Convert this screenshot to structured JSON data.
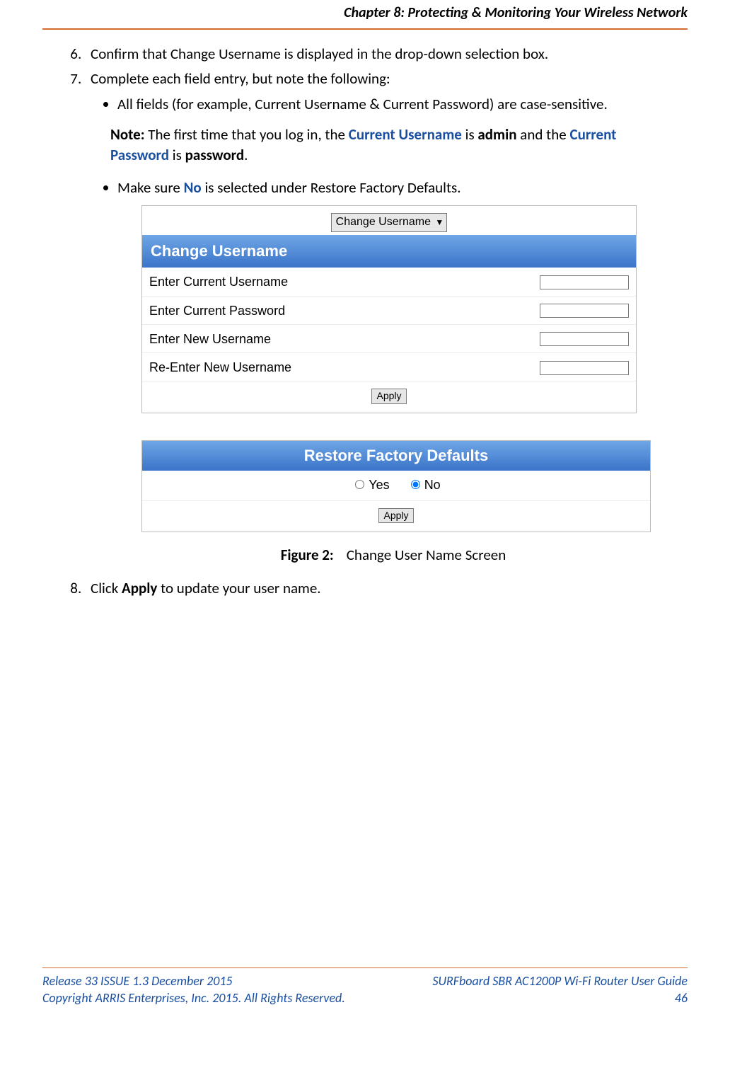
{
  "header": {
    "chapter_title": "Chapter 8: Protecting & Monitoring Your Wireless Network"
  },
  "steps": {
    "six": "Confirm that Change Username is displayed in the drop-down selection box.",
    "seven": "Complete each field entry, but note the following:",
    "bullet_a": "All fields (for example, Current Username & Current Password) are case-sensitive.",
    "note_label": "Note:",
    "note_1": " The first time that you log in, the ",
    "note_cu": "Current Username",
    "note_2": " is ",
    "note_admin": "admin",
    "note_3": " and the ",
    "note_cp": "Current Password",
    "note_4": " is ",
    "note_pw": "password",
    "note_5": ".",
    "bullet_b_1": "Make sure ",
    "bullet_b_no": "No",
    "bullet_b_2": " is selected under Restore Factory Defaults.",
    "eight_1": "Click ",
    "eight_apply": "Apply",
    "eight_2": " to update your user name."
  },
  "panel1": {
    "dropdown": "Change Username",
    "section_title": "Change Username",
    "row1": "Enter Current Username",
    "row2": "Enter Current Password",
    "row3": "Enter New Username",
    "row4": "Re-Enter New Username",
    "apply": "Apply"
  },
  "panel2": {
    "section_title": "Restore Factory Defaults",
    "yes": "Yes",
    "no": "No",
    "apply": "Apply"
  },
  "caption": {
    "label": "Figure 2:",
    "text": "Change User Name Screen"
  },
  "footer": {
    "left1": "Release 33 ISSUE 1.3    December 2015",
    "left2": "Copyright ARRIS Enterprises, Inc. 2015. All Rights Reserved.",
    "right1": "SURFboard SBR AC1200P Wi-Fi Router User Guide",
    "right2": "46"
  }
}
